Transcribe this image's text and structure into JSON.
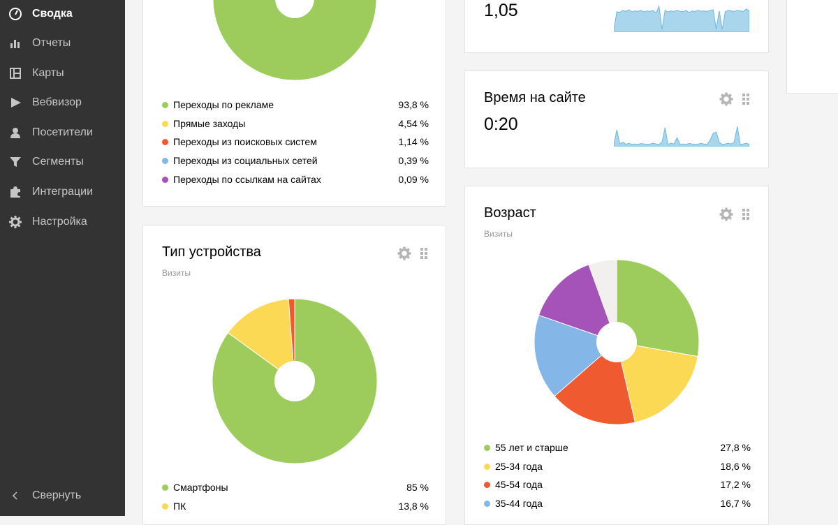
{
  "sidebar": {
    "items": [
      {
        "label": "Сводка",
        "icon": "dashboard-icon",
        "active": true
      },
      {
        "label": "Отчеты",
        "icon": "bar-chart-icon"
      },
      {
        "label": "Карты",
        "icon": "map-icon"
      },
      {
        "label": "Вебвизор",
        "icon": "play-icon"
      },
      {
        "label": "Посетители",
        "icon": "user-icon"
      },
      {
        "label": "Сегменты",
        "icon": "filter-icon"
      },
      {
        "label": "Интеграции",
        "icon": "puzzle-icon"
      },
      {
        "label": "Настройка",
        "icon": "gear-icon"
      }
    ],
    "collapse_label": "Свернуть"
  },
  "traffic_sources": {
    "legend": [
      {
        "label": "Переходы по рекламе",
        "value": "93,8 %",
        "color": "#9dcc5c"
      },
      {
        "label": "Прямые заходы",
        "value": "4,54 %",
        "color": "#fcd954"
      },
      {
        "label": "Переходы из поисковых систем",
        "value": "1,14 %",
        "color": "#f05a31"
      },
      {
        "label": "Переходы из социальных сетей",
        "value": "0,39 %",
        "color": "#84b6e8"
      },
      {
        "label": "Переходы по ссылкам на сайтах",
        "value": "0,09 %",
        "color": "#a553b9"
      }
    ]
  },
  "depth": {
    "value": "1,05"
  },
  "time_on_site": {
    "title": "Время на сайте",
    "value": "0:20"
  },
  "device": {
    "title": "Тип устройства",
    "subtitle": "Визиты",
    "legend": [
      {
        "label": "Смартфоны",
        "value": "85 %",
        "color": "#9dcc5c"
      },
      {
        "label": "ПК",
        "value": "13,8 %",
        "color": "#fcd954"
      }
    ]
  },
  "age": {
    "title": "Возраст",
    "subtitle": "Визиты",
    "legend": [
      {
        "label": "55 лет и старше",
        "value": "27,8 %",
        "color": "#9dcc5c"
      },
      {
        "label": "25-34 года",
        "value": "18,6 %",
        "color": "#fcd954"
      },
      {
        "label": "45-54 года",
        "value": "17,2 %",
        "color": "#f05a31"
      },
      {
        "label": "35-44 года",
        "value": "16,7 %",
        "color": "#84b6e8"
      }
    ]
  },
  "chart_data": [
    {
      "type": "pie",
      "categories": [
        "Переходы по рекламе",
        "Прямые заходы",
        "Переходы из поисковых систем",
        "Переходы из социальных сетей",
        "Переходы по ссылкам на сайтах"
      ],
      "values": [
        93.8,
        4.54,
        1.14,
        0.39,
        0.09
      ],
      "colors": [
        "#9dcc5c",
        "#fcd954",
        "#f05a31",
        "#84b6e8",
        "#a553b9"
      ]
    },
    {
      "type": "pie",
      "categories": [
        "Смартфоны",
        "ПК",
        ""
      ],
      "values": [
        85,
        13.8,
        1.2
      ],
      "colors": [
        "#9dcc5c",
        "#fcd954",
        "#f05a31"
      ]
    },
    {
      "type": "pie",
      "categories": [
        "55 лет и старше",
        "25-34 года",
        "45-54 года",
        "35-44 года",
        "",
        ""
      ],
      "values": [
        27.8,
        18.6,
        17.2,
        16.7,
        14.2,
        5.5
      ],
      "colors": [
        "#9dcc5c",
        "#fcd954",
        "#f05a31",
        "#84b6e8",
        "#a553b9",
        "#f2f0ee"
      ]
    },
    {
      "type": "area",
      "values": [
        0.1,
        0.75,
        0.72,
        0.8,
        0.76,
        0.82,
        0.74,
        0.78,
        0.76,
        0.8,
        0.75,
        0.78,
        0.76,
        0.8,
        0.7,
        0.95,
        0.1,
        0.8,
        0.74,
        0.78,
        0.76,
        0.8,
        0.76,
        0.75,
        0.8,
        0.72,
        0.78,
        0.76,
        0.8,
        0.77,
        0.78,
        0.76,
        0.8,
        0.82,
        0.1,
        0.78,
        0.1,
        0.75,
        0.8,
        0.78,
        0.76,
        0.8,
        0.78,
        0.76,
        0.85,
        0.78
      ],
      "color": "#a9d6ec"
    },
    {
      "type": "area",
      "values": [
        0.1,
        0.75,
        0.12,
        0.2,
        0.1,
        0.15,
        0.1,
        0.12,
        0.1,
        0.14,
        0.12,
        0.1,
        0.12,
        0.15,
        0.12,
        0.1,
        0.2,
        0.85,
        0.1,
        0.15,
        0.12,
        0.4,
        0.1,
        0.12,
        0.1,
        0.14,
        0.12,
        0.1,
        0.12,
        0.14,
        0.12,
        0.1,
        0.3,
        0.6,
        0.65,
        0.2,
        0.1,
        0.12,
        0.15,
        0.12,
        0.2,
        0.9,
        0.1,
        0.12,
        0.15,
        0.1
      ],
      "color": "#a9d6ec"
    }
  ]
}
